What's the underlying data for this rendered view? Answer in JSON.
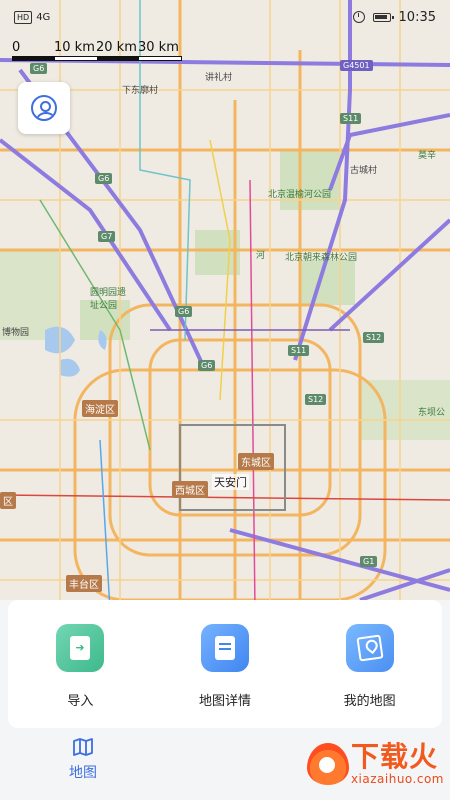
{
  "status_bar": {
    "left_badge": "HD",
    "left_signal": "4G",
    "time": "10:35"
  },
  "scale": {
    "labels": [
      "0",
      "10 km",
      "20 km",
      "30 km"
    ]
  },
  "map": {
    "labels": [
      {
        "text": "下东廓村",
        "kind": "plain"
      },
      {
        "text": "讲礼村",
        "kind": "plain"
      },
      {
        "text": "北京温榆河公园",
        "kind": "green"
      },
      {
        "text": "北京朝来森林公园",
        "kind": "green"
      },
      {
        "text": "圆明园遗址公园",
        "kind": "green"
      },
      {
        "text": "古城村",
        "kind": "plain"
      },
      {
        "text": "莫辛",
        "kind": "green"
      },
      {
        "text": "博物园",
        "kind": "plain"
      },
      {
        "text": "东坝公",
        "kind": "green"
      },
      {
        "text": "河",
        "kind": "green"
      }
    ],
    "districts": [
      "海淀区",
      "东城区",
      "西城区",
      "丰台区",
      "区"
    ],
    "shields": [
      "G6",
      "G6",
      "G7",
      "G6",
      "G6",
      "G4501",
      "S11",
      "S11",
      "S12",
      "S12",
      "G1"
    ],
    "landmark": "天安门"
  },
  "actions": [
    {
      "label": "导入",
      "icon": "import-icon"
    },
    {
      "label": "地图详情",
      "icon": "map-detail-icon"
    },
    {
      "label": "我的地图",
      "icon": "my-map-icon"
    }
  ],
  "tabbar": {
    "map_tab_label": "地图",
    "accent_color": "#3d6fe0"
  },
  "watermark": {
    "title": "下载火",
    "subtitle": "xiazaihuo.com"
  }
}
